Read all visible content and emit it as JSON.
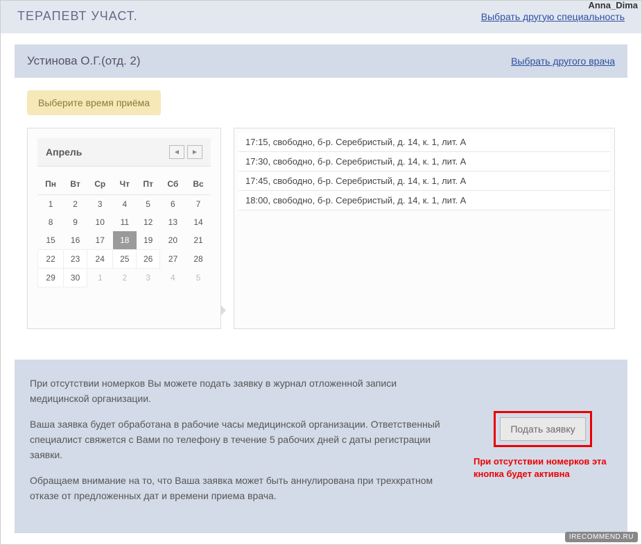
{
  "watermark": {
    "user": "Anna_Dima",
    "site": "IRECOMMEND.RU"
  },
  "header": {
    "speciality": "ТЕРАПЕВТ УЧАСТ.",
    "change_speciality": "Выбрать другую специальность"
  },
  "doctor": {
    "name": "Устинова О.Г.(отд. 2)",
    "change_doctor": "Выбрать другого врача"
  },
  "prompt_badge": "Выберите время приёма",
  "calendar": {
    "month": "Апрель",
    "weekdays": [
      "Пн",
      "Вт",
      "Ср",
      "Чт",
      "Пт",
      "Сб",
      "Вс"
    ],
    "weeks": [
      [
        {
          "d": "1"
        },
        {
          "d": "2"
        },
        {
          "d": "3"
        },
        {
          "d": "4"
        },
        {
          "d": "5"
        },
        {
          "d": "6"
        },
        {
          "d": "7"
        }
      ],
      [
        {
          "d": "8"
        },
        {
          "d": "9"
        },
        {
          "d": "10"
        },
        {
          "d": "11"
        },
        {
          "d": "12"
        },
        {
          "d": "13"
        },
        {
          "d": "14"
        }
      ],
      [
        {
          "d": "15"
        },
        {
          "d": "16"
        },
        {
          "d": "17"
        },
        {
          "d": "18",
          "selected": true
        },
        {
          "d": "19"
        },
        {
          "d": "20"
        },
        {
          "d": "21"
        }
      ],
      [
        {
          "d": "22",
          "avail": true
        },
        {
          "d": "23",
          "avail": true
        },
        {
          "d": "24",
          "avail": true
        },
        {
          "d": "25",
          "avail": true
        },
        {
          "d": "26",
          "avail": true
        },
        {
          "d": "27"
        },
        {
          "d": "28"
        }
      ],
      [
        {
          "d": "29",
          "avail": true
        },
        {
          "d": "30",
          "avail": true
        },
        {
          "d": "1",
          "dim": true
        },
        {
          "d": "2",
          "dim": true
        },
        {
          "d": "3",
          "dim": true
        },
        {
          "d": "4",
          "dim": true
        },
        {
          "d": "5",
          "dim": true
        }
      ]
    ]
  },
  "slots": [
    "17:15, свободно, б-р. Серебристый, д. 14, к. 1, лит. А",
    "17:30, свободно, б-р. Серебристый, д. 14, к. 1, лит. А",
    "17:45, свободно, б-р. Серебристый, д. 14, к. 1, лит. А",
    "18:00, свободно, б-р. Серебристый, д. 14, к. 1, лит. А"
  ],
  "note": {
    "p1": "При отсутствии номерков Вы можете подать заявку в журнал отложенной записи медицинской организации.",
    "p2": "Ваша заявка будет обработана в рабочие часы медицинской организации. Ответственный специалист свяжется с Вами по телефону в течение 5 рабочих дней с даты регистрации заявки.",
    "p3": "Обращаем внимание на то, что Ваша заявка может быть аннулирована при трехкратном отказе от предложенных дат и времени приема врача.",
    "button": "Подать заявку",
    "red": "При отсутствии номерков эта кнопка будет активна"
  }
}
